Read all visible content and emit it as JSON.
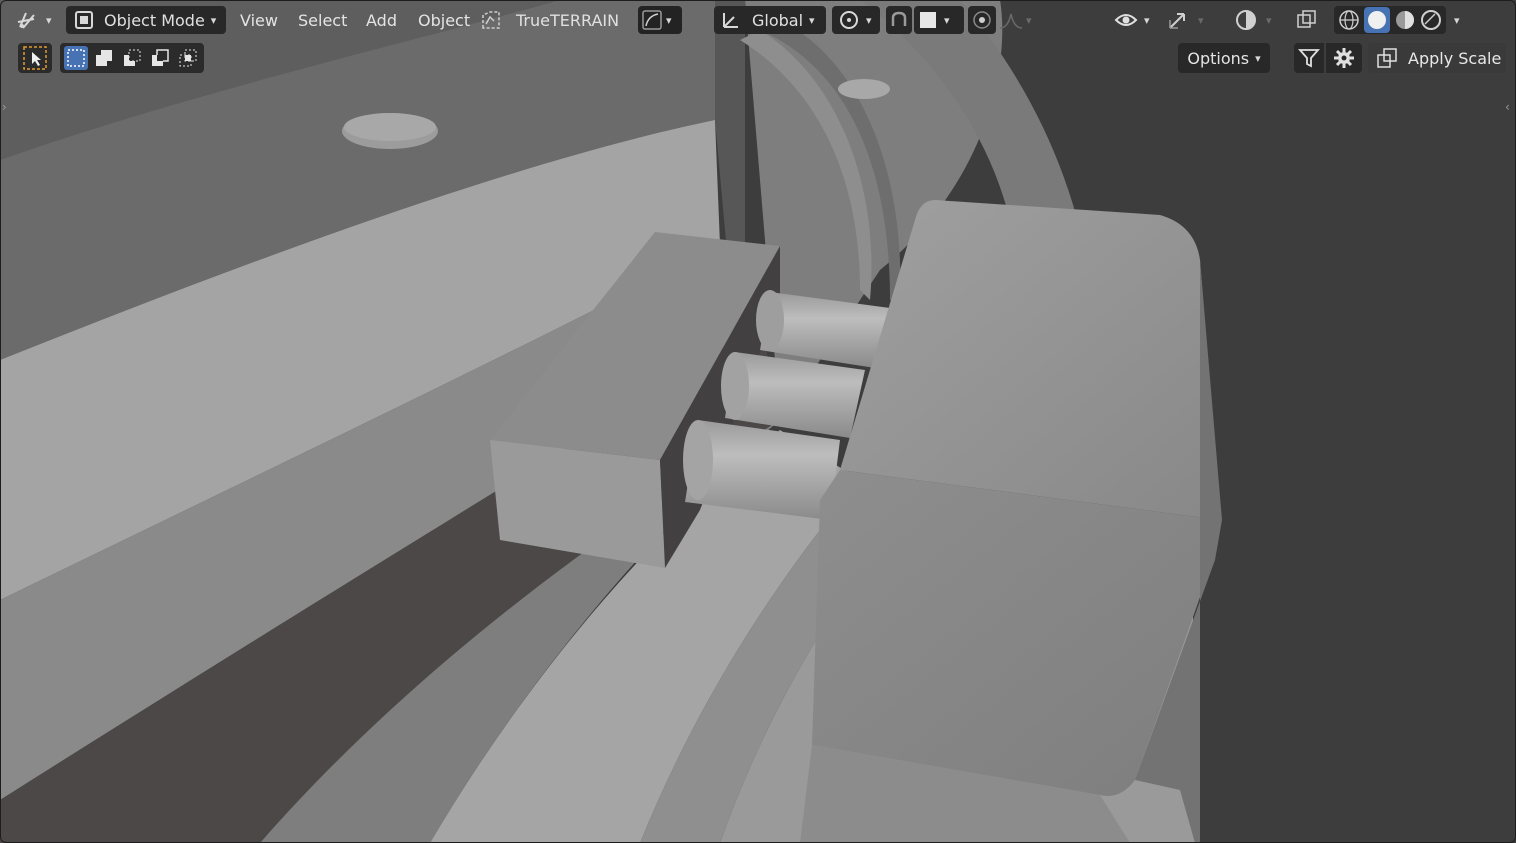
{
  "header": {
    "mode_label": "Object Mode",
    "menus": [
      "View",
      "Select",
      "Add",
      "Object"
    ],
    "addon_label": "TrueTERRAIN",
    "orientation_label": "Global"
  },
  "toolbar2": {
    "options_label": "Options",
    "apply_scale_label": "Apply Scale"
  },
  "icons": {
    "editor_type": "editor-type-icon",
    "mode": "object-mode-icon",
    "addon": "trueterrain-icon",
    "orientation": "transform-orientation-icon",
    "pivot": "pivot-point-icon",
    "snap": "snap-icon",
    "proportional": "proportional-editing-icon",
    "visibility": "visibility-eye-icon",
    "gizmo": "gizmo-icon",
    "overlay": "overlay-icon",
    "xray": "xray-icon",
    "shading_modes": [
      "wireframe-shading-icon",
      "solid-shading-icon",
      "material-preview-icon",
      "rendered-shading-icon"
    ]
  },
  "colors": {
    "accent": "#4772b3",
    "header_bg": "#282828",
    "viewport_bg": "#3d3d3d"
  }
}
